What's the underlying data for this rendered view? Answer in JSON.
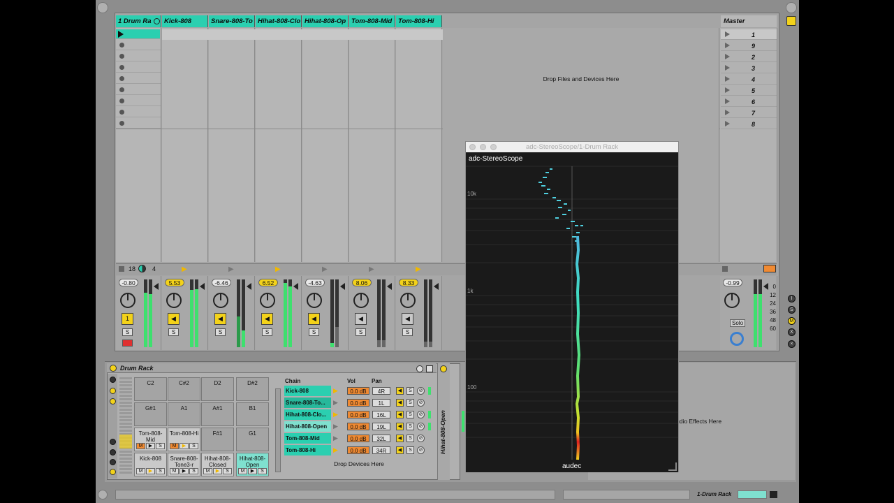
{
  "session": {
    "group_track": "1 Drum Ra",
    "tracks": [
      "Kick-808",
      "Snare-808-To",
      "Hihat-808-Clo",
      "Hihat-808-Op",
      "Tom-808-Mid",
      "Tom-808-Hi"
    ],
    "drop_zone": "Drop Files and Devices Here",
    "master_label": "Master",
    "scenes": [
      "1",
      "9",
      "2",
      "3",
      "4",
      "5",
      "6",
      "7",
      "8"
    ]
  },
  "mixer": {
    "group_volume": "-0.80",
    "group_left_num": "18",
    "group_right_num": "4",
    "track_volumes": [
      "5.53",
      "-6.46",
      "6.52",
      "-4.63",
      "8.06",
      "8.33"
    ],
    "master_volume": "-0.99",
    "solo_label": "Solo",
    "db_scale": [
      "0",
      "12",
      "24",
      "36",
      "48",
      "60"
    ],
    "activator_label": "1",
    "solo_btn": "S"
  },
  "drum_rack": {
    "title": "Drum Rack",
    "pads": [
      {
        "label": "C2"
      },
      {
        "label": "C#2"
      },
      {
        "label": "D2"
      },
      {
        "label": "D#2"
      },
      {
        "label": "G#1"
      },
      {
        "label": "A1"
      },
      {
        "label": "A#1"
      },
      {
        "label": "B1"
      },
      {
        "label": "Tom-808-Mid"
      },
      {
        "label": "Tom-808-Hi"
      },
      {
        "label": "F#1"
      },
      {
        "label": "G1"
      },
      {
        "label": "Kick-808"
      },
      {
        "label": "Snare-808-Tone3-r"
      },
      {
        "label": "Hihat-808-Closed"
      },
      {
        "label": "Hihat-808-Open"
      }
    ],
    "pad_ctl": [
      "M",
      "▶",
      "S"
    ],
    "chain_header": "Chain",
    "vol_header": "Vol",
    "pan_header": "Pan",
    "chains": [
      {
        "name": "Kick-808",
        "vol": "0.0 dB",
        "pan": "4R"
      },
      {
        "name": "Snare-808-To...",
        "vol": "0.0 dB",
        "pan": "1L"
      },
      {
        "name": "Hihat-808-Clo...",
        "vol": "0.0 dB",
        "pan": "16L"
      },
      {
        "name": "Hihat-808-Open",
        "vol": "0.0 dB",
        "pan": "19L"
      },
      {
        "name": "Tom-808-Mid",
        "vol": "0.0 dB",
        "pan": "32L"
      },
      {
        "name": "Tom-808-Hi",
        "vol": "0.0 dB",
        "pan": "34R"
      }
    ],
    "chain_drop": "Drop Devices Here",
    "chain_s": "S",
    "selected_chain_label": "Hihat-808-Open"
  },
  "audio_effects_hint": "udio Effects Here",
  "plugin": {
    "window_title": "adc-StereoScope/1-Drum Rack",
    "name": "adc-StereoScope",
    "freq_labels": [
      "10k",
      "1k",
      "100"
    ],
    "brand": "audec"
  },
  "status": {
    "selected_track": "1-Drum Rack"
  },
  "colors": {
    "track": "#2bcfb0",
    "accent": "#f3d21a",
    "background": "#8d8d8d",
    "plugin_bg": "#1c1c1c"
  }
}
